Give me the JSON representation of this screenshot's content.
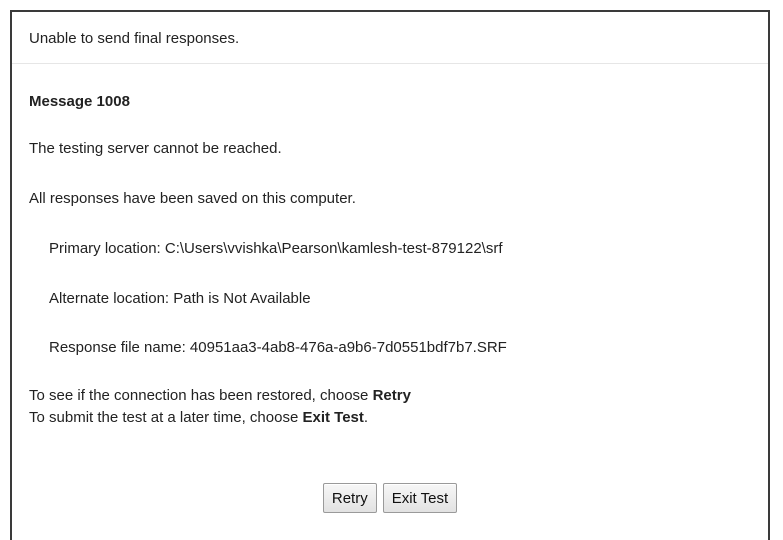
{
  "dialog": {
    "header": "Unable to send final responses.",
    "message_title": "Message 1008",
    "line_server": "The testing server cannot be reached.",
    "line_saved": "All responses have been saved on this computer.",
    "primary_location": "Primary location: C:\\Users\\vvishka\\Pearson\\kamlesh-test-879122\\srf",
    "alternate_location": "Alternate location: Path is Not Available",
    "response_file": "Response file name: 40951aa3-4ab8-476a-a9b6-7d0551bdf7b7.SRF",
    "retry_prefix": "To see if the connection has been restored, choose ",
    "retry_strong": "Retry",
    "exit_prefix": "To submit the test at a later time, choose ",
    "exit_strong": "Exit Test",
    "exit_suffix": "."
  },
  "buttons": {
    "retry_label": "Retry",
    "exit_label": "Exit Test"
  }
}
